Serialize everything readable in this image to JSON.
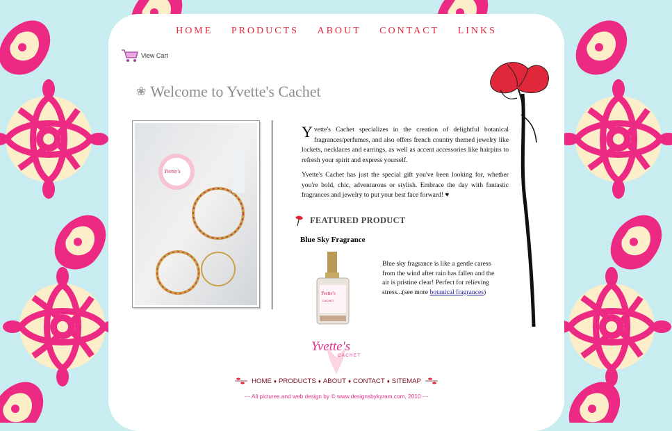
{
  "nav": {
    "items": [
      "HOME",
      "PRODUCTS",
      "ABOUT",
      "CONTACT",
      "LINKS"
    ]
  },
  "cart": {
    "label": "View Cart",
    "icon": "shopping-cart-icon"
  },
  "welcome": {
    "title": "Welcome to Yvette's Cachet",
    "icon": "flower-icon"
  },
  "intro": {
    "dropcap": "Y",
    "para1": "vette's Cachet specializes in the creation of delightful botanical fragrances/perfumes, and also offers french country themed jewelry like lockets, necklaces and earrings, as well as accent accessories like hairpins to refresh your spirit and express yourself.",
    "para2": "Yvette's Cachet has just the special gift you've been looking for, whether you're bold, chic, adventurous or stylish. Embrace the day with fantastic fragrances and jewelry to put your best face forward! ♥"
  },
  "featured": {
    "heading": "FEATURED PRODUCT",
    "product_name": "Blue Sky Fragrance",
    "description": "Blue sky fragrance is like a gentle caress from the wind after rain has fallen and the air is pristine clear! Perfect for relieving stress...(see more ",
    "link_text": "botanical fragrances",
    "closing": ")"
  },
  "logo": {
    "line1": "Yvette's",
    "line2": "CACHET"
  },
  "footer": {
    "links": [
      "HOME",
      "PRODUCTS",
      "ABOUT",
      "CONTACT",
      "SITEMAP"
    ],
    "separator": "♦",
    "credit": "-·- All pictures and web design by © www.designsbykyram.com, 2010 -·-"
  },
  "colors": {
    "background": "#c8ecef",
    "nav_red": "#e0283a",
    "floral_pink": "#ec2a84",
    "floral_cream": "#fbeec8",
    "footer_link": "#7a1220",
    "credit_pink": "#e0308a"
  }
}
